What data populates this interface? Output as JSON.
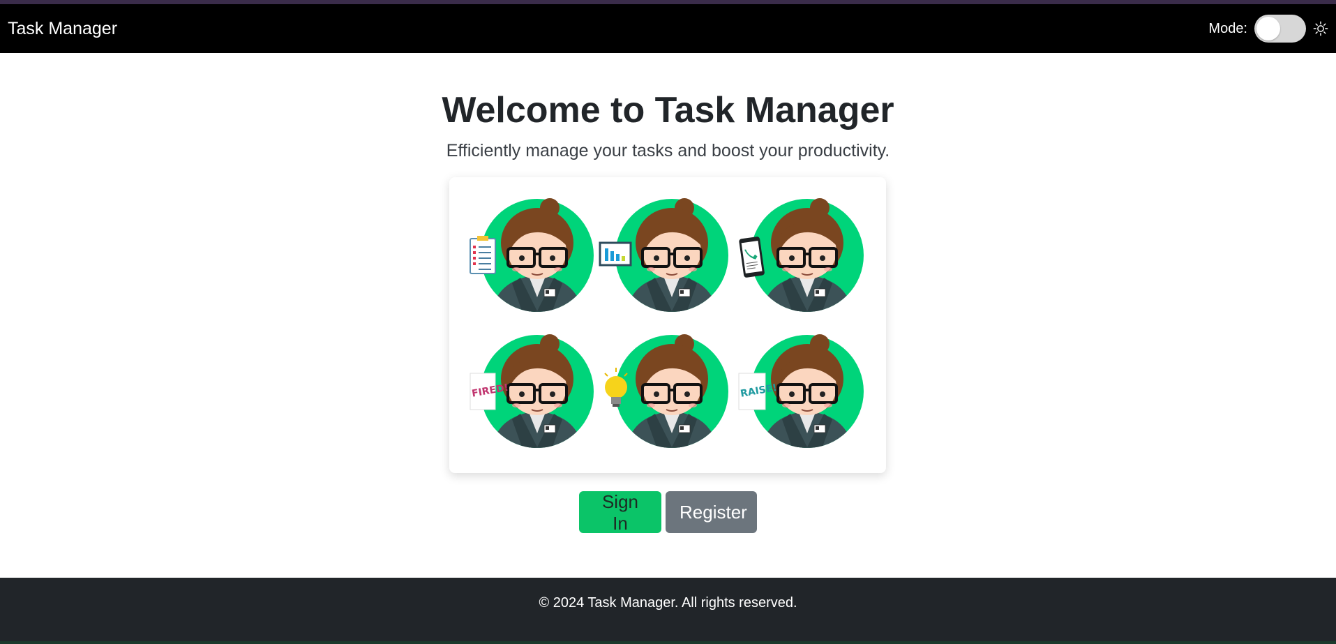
{
  "nav": {
    "brand": "Task Manager",
    "mode_label": "Mode:"
  },
  "hero": {
    "title": "Welcome to Task Manager",
    "subtitle": "Efficiently manage your tasks and boost your productivity."
  },
  "illustration": {
    "props": [
      "clipboard-icon",
      "chart-icon",
      "phone-icon",
      "fired-sign-icon",
      "lightbulb-icon",
      "raise-sign-icon"
    ],
    "fired_text": "FIRED!",
    "raise_text": "RAISE!"
  },
  "actions": {
    "sign_in": "Sign In",
    "register": "Register"
  },
  "footer": {
    "text": "© 2024 Task Manager. All rights reserved."
  },
  "colors": {
    "accent_green": "#0bc468",
    "avatar_bg": "#00d47a",
    "secondary": "#6c757d",
    "footer_bg": "#212529"
  }
}
